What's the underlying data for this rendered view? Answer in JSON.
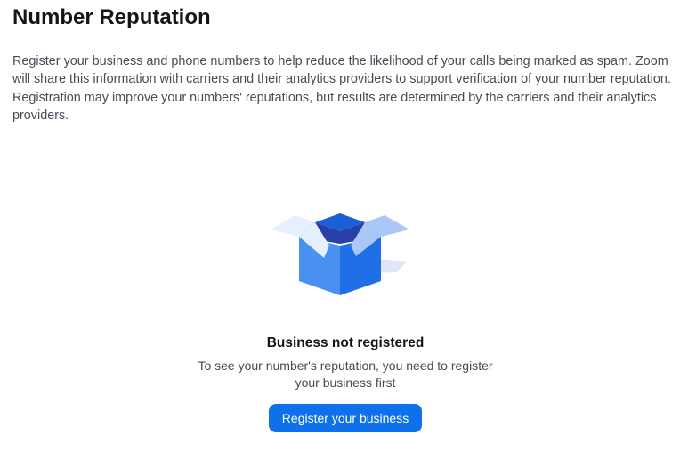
{
  "page": {
    "title": "Number Reputation",
    "description": "Register your business and phone numbers to help reduce the likelihood of your calls being marked as spam. Zoom will share this information with carriers and their analytics providers to support verification of your number reputation. Registration may improve your numbers' reputations, but results are determined by the carriers and their analytics providers."
  },
  "empty_state": {
    "icon": "open-box-icon",
    "title": "Business not registered",
    "subtitle": "To see your number's reputation, you need to register your business first",
    "button_label": "Register your business"
  },
  "colors": {
    "accent": "#0e71eb",
    "title_text": "#131619",
    "body_text": "#4a4a57",
    "box_light": "#4a90f0",
    "box_dark": "#1a5fd8",
    "box_flap_light": "#e6efff"
  }
}
